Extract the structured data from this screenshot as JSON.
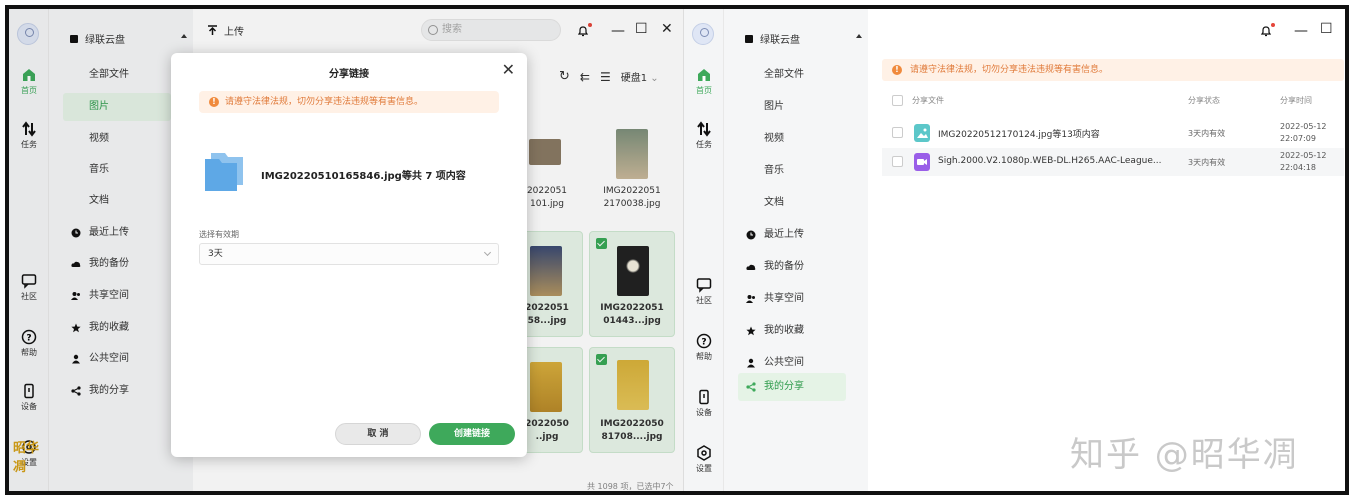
{
  "left_window": {
    "rail": [
      {
        "label": "首页",
        "icon": "home-icon"
      },
      {
        "label": "任务",
        "icon": "transfer-icon"
      },
      {
        "label": "社区",
        "icon": "chat-icon"
      },
      {
        "label": "帮助",
        "icon": "help-icon"
      },
      {
        "label": "设备",
        "icon": "device-icon"
      },
      {
        "label": "设置",
        "icon": "settings-icon"
      }
    ],
    "nav": {
      "root": "绿联云盘",
      "items": [
        "全部文件",
        "图片",
        "视频",
        "音乐",
        "文档",
        "最近上传",
        "我的备份",
        "共享空间",
        "我的收藏",
        "公共空间",
        "我的分享"
      ],
      "active": "图片"
    },
    "topbar": {
      "upload": "上传",
      "search_placeholder": "搜索"
    },
    "toolbar": {
      "disk": "硬盘1"
    },
    "tiles": [
      {
        "name1": "IMG2022051",
        "name2": "2170038.jpg",
        "selected": false
      },
      {
        "name1": "IMG2022051",
        "name2": "01443...jpg",
        "selected": true
      },
      {
        "name1": "IMG2022050",
        "name2": "81708....jpg",
        "selected": true
      }
    ],
    "partial_tiles": [
      {
        "name1": "2022051",
        "name2": "101.jpg"
      },
      {
        "name1": "2022051",
        "name2": "58...jpg"
      },
      {
        "name1": "2022050",
        "name2": "..jpg"
      }
    ],
    "footer": "共 1098 项，已选中7个",
    "logo": "昭华凋"
  },
  "dialog": {
    "title": "分享链接",
    "warning": "请遵守法律法规，切勿分享违法违规等有害信息。",
    "filename": "IMG20220510165846.jpg等共 7 项内容",
    "period_label": "选择有效期",
    "period_value": "3天",
    "cancel": "取 消",
    "create": "创建链接"
  },
  "right_window": {
    "rail": [
      {
        "label": "首页",
        "icon": "home-icon"
      },
      {
        "label": "任务",
        "icon": "transfer-icon"
      },
      {
        "label": "社区",
        "icon": "chat-icon"
      },
      {
        "label": "帮助",
        "icon": "help-icon"
      },
      {
        "label": "设备",
        "icon": "device-icon"
      },
      {
        "label": "设置",
        "icon": "settings-icon"
      }
    ],
    "nav": {
      "root": "绿联云盘",
      "items": [
        "全部文件",
        "图片",
        "视频",
        "音乐",
        "文档",
        "最近上传",
        "我的备份",
        "共享空间",
        "我的收藏",
        "公共空间",
        "我的分享"
      ],
      "active": "我的分享"
    },
    "warning": "请遵守法律法规，切勿分享违法违规等有害信息。",
    "table": {
      "headers": [
        "分享文件",
        "分享状态",
        "分享时间"
      ],
      "rows": [
        {
          "name": "IMG20220512170124.jpg等13项内容",
          "status": "3天内有效",
          "date": "2022-05-12",
          "time": "22:07:09",
          "type": "image"
        },
        {
          "name": "Sigh.2000.V2.1080p.WEB-DL.H265.AAC-League...",
          "status": "3天内有效",
          "date": "2022-05-12",
          "time": "22:04:18",
          "type": "video"
        }
      ]
    },
    "watermark": "知乎 @昭华凋"
  },
  "colors": {
    "accent": "#3ea95b",
    "warning_text": "#e07a3a",
    "warning_bg": "#fff1e6"
  }
}
